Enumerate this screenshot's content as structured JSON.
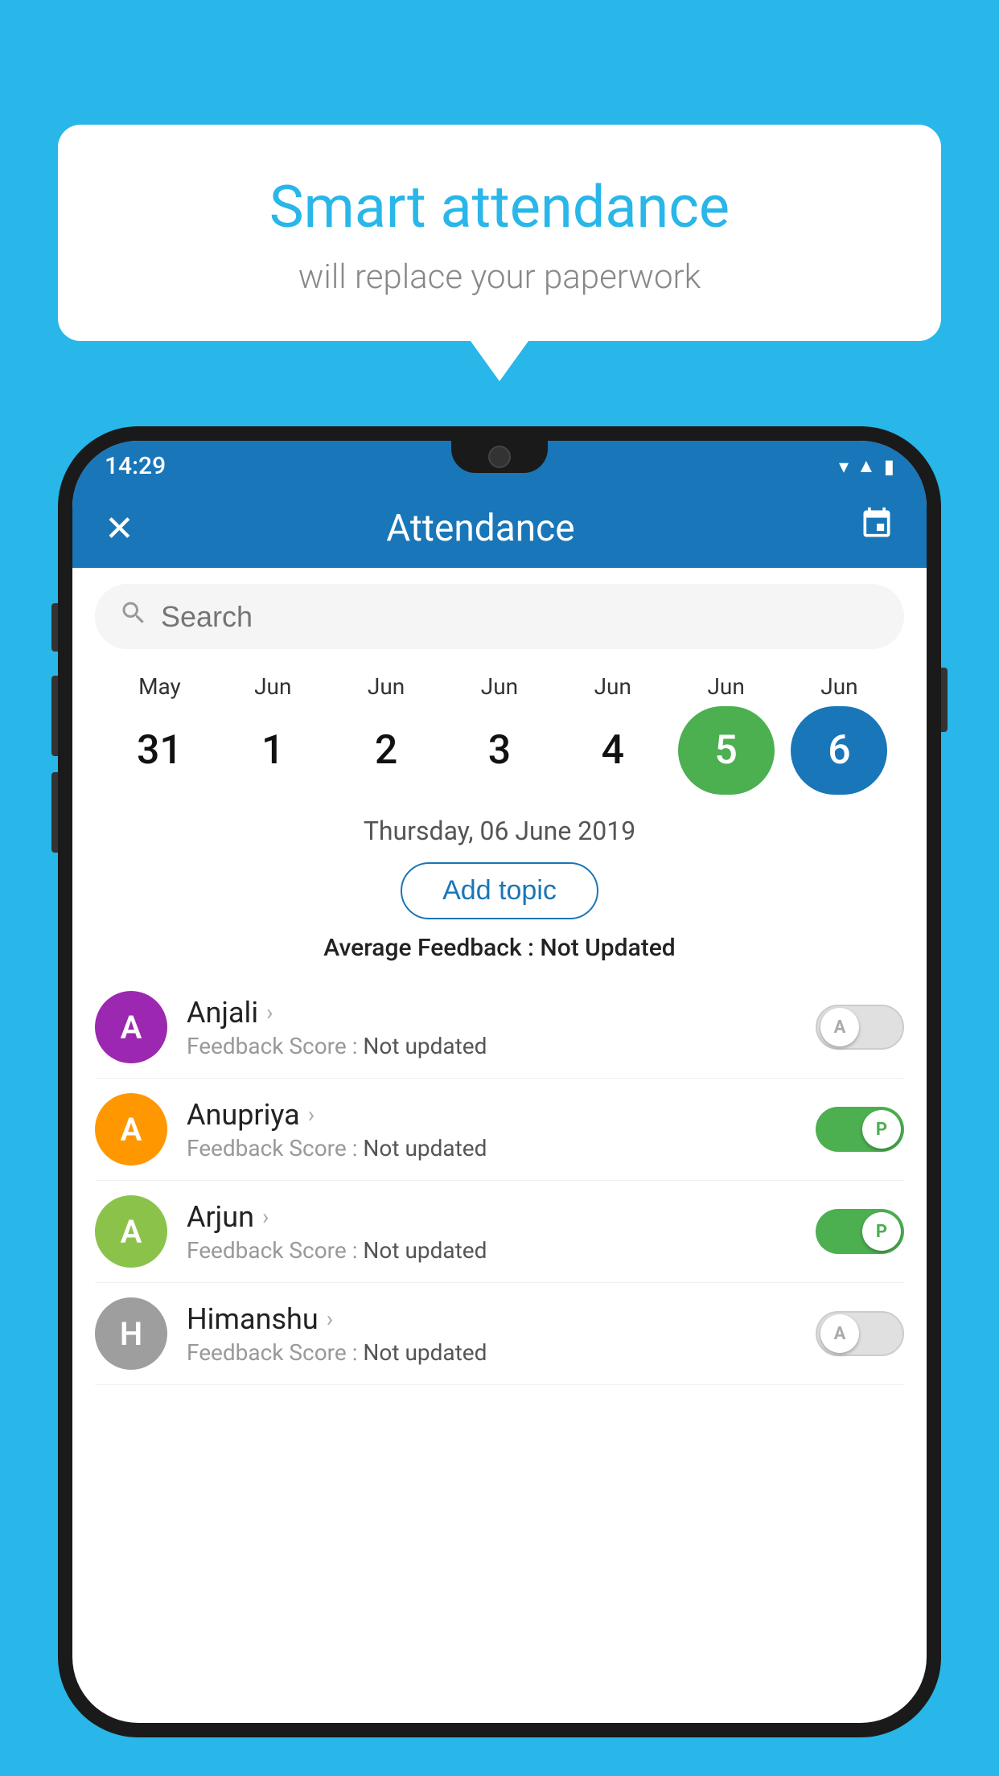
{
  "background_color": "#29b6e8",
  "speech_bubble": {
    "title": "Smart attendance",
    "subtitle": "will replace your paperwork"
  },
  "status_bar": {
    "time": "14:29",
    "wifi_icon": "▼",
    "signal_icon": "▲",
    "battery_icon": "▮"
  },
  "app_bar": {
    "close_icon": "✕",
    "title": "Attendance",
    "calendar_icon": "📅"
  },
  "search": {
    "placeholder": "Search"
  },
  "calendar": {
    "months": [
      "May",
      "Jun",
      "Jun",
      "Jun",
      "Jun",
      "Jun",
      "Jun"
    ],
    "dates": [
      "31",
      "1",
      "2",
      "3",
      "4",
      "5",
      "6"
    ],
    "states": [
      "normal",
      "normal",
      "normal",
      "normal",
      "normal",
      "today",
      "selected"
    ]
  },
  "selected_date": "Thursday, 06 June 2019",
  "add_topic_label": "Add topic",
  "avg_feedback_label": "Average Feedback :",
  "avg_feedback_value": "Not Updated",
  "students": [
    {
      "name": "Anjali",
      "avatar_letter": "A",
      "avatar_color": "#9c27b0",
      "feedback_label": "Feedback Score :",
      "feedback_value": "Not updated",
      "toggle_state": "off",
      "toggle_label": "A"
    },
    {
      "name": "Anupriya",
      "avatar_letter": "A",
      "avatar_color": "#ff9800",
      "feedback_label": "Feedback Score :",
      "feedback_value": "Not updated",
      "toggle_state": "on",
      "toggle_label": "P"
    },
    {
      "name": "Arjun",
      "avatar_letter": "A",
      "avatar_color": "#8bc34a",
      "feedback_label": "Feedback Score :",
      "feedback_value": "Not updated",
      "toggle_state": "on",
      "toggle_label": "P"
    },
    {
      "name": "Himanshu",
      "avatar_letter": "H",
      "avatar_color": "#9e9e9e",
      "feedback_label": "Feedback Score :",
      "feedback_value": "Not updated",
      "toggle_state": "off",
      "toggle_label": "A"
    }
  ]
}
